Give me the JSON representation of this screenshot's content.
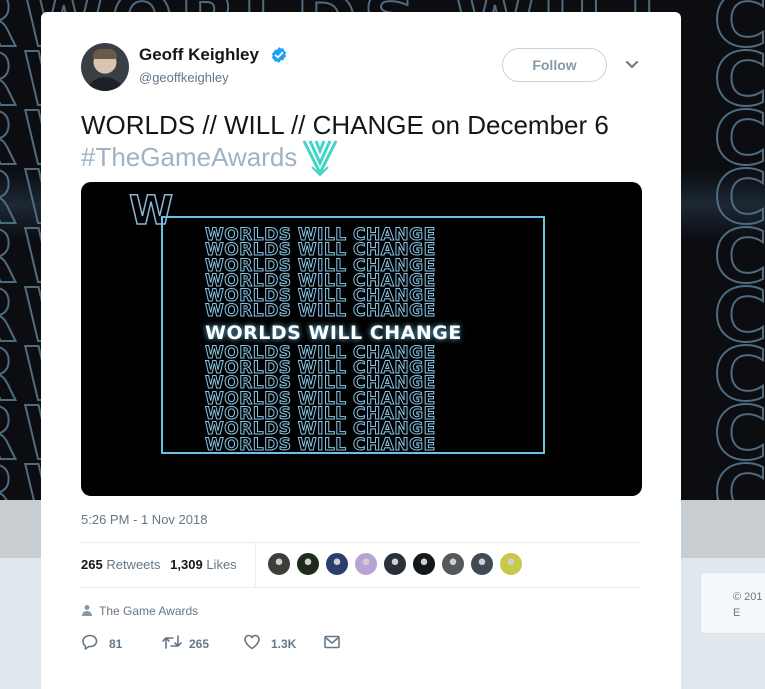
{
  "backdrop": {
    "lines": [
      "RWORLDS WILL CHAN",
      "RWORLDS WILL CHAN",
      "RWORLDS WILL CHAN",
      "RWORLDS WILL CHAN",
      "RWORLDS WILL CHAN",
      "RWORLDS WILL CHAN",
      "RWORLDS WILL CHAN",
      "RWORLDS WILL CHAN",
      "RWORLDS WILL CHAN"
    ],
    "side_text": "© 201\nE"
  },
  "tweet": {
    "author_name": "Geoff Keighley",
    "author_handle": "@geoffkeighley",
    "follow_label": "Follow",
    "text": "WORLDS // WILL // CHANGE on December 6",
    "hashtag": "#TheGameAwards",
    "media": {
      "logo_letter": "W",
      "rows_before": [
        "WORLDS WILL CHANGE",
        "WORLDS WILL CHANGE",
        "WORLDS WILL CHANGE",
        "WORLDS WILL CHANGE",
        "WORLDS WILL CHANGE",
        "WORLDS WILL CHANGE"
      ],
      "highlight": "WORLDS WILL CHANGE",
      "rows_after": [
        "WORLDS WILL CHANGE",
        "WORLDS WILL CHANGE",
        "WORLDS WILL CHANGE",
        "WORLDS WILL CHANGE",
        "WORLDS WILL CHANGE",
        "WORLDS WILL CHANGE",
        "WORLDS WILL CHANGE"
      ]
    },
    "timestamp": "5:26 PM - 1 Nov 2018",
    "retweets_count": "265",
    "retweets_label": "Retweets",
    "likes_count": "1,309",
    "likes_label": "Likes",
    "liker_colors": [
      "#3b3f38",
      "#1e2a1a",
      "#2c3e6b",
      "#b9a3d6",
      "#2a3038",
      "#14181d",
      "#55585c",
      "#3f4a55",
      "#c8c84a"
    ],
    "source": "The Game Awards",
    "actions": {
      "reply": "81",
      "retweet": "265",
      "like": "1.3K"
    },
    "colors": {
      "accent": "#1da1f2",
      "hashtag": "#9fb3c5",
      "muted": "#657786",
      "hashflag": "#3fd6c4"
    }
  }
}
